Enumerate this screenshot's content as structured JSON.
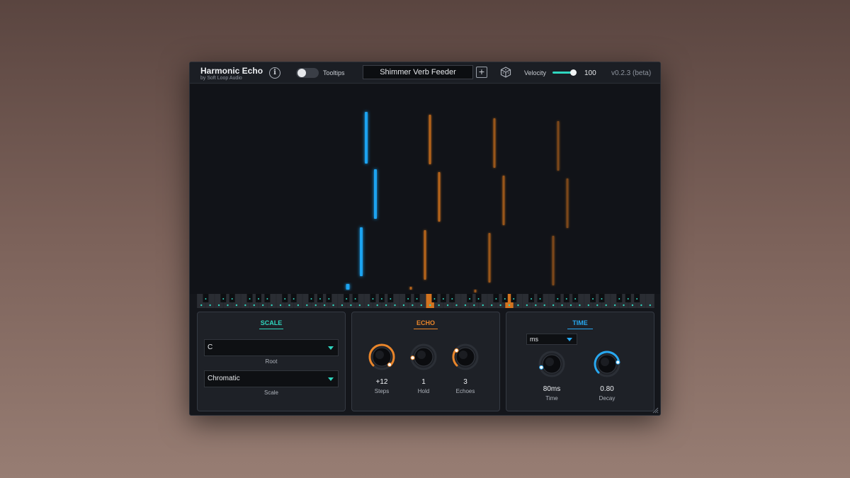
{
  "header": {
    "title": "Harmonic Echo",
    "subtitle": "by Soft Loop Audio",
    "info_glyph": "i",
    "tooltips_label": "Tooltips",
    "tooltips_on": false,
    "preset_name": "Shimmer Verb Feeder",
    "add_glyph": "+",
    "velocity_label": "Velocity",
    "velocity_value": "100",
    "velocity_fraction": 1.0,
    "version": "v0.2.3 (beta)"
  },
  "colors": {
    "accent_teal": "#2fd6bf",
    "echo_orange": "#e9852a",
    "time_blue": "#28a8f0",
    "note_blue": "#1aa3f0",
    "note_orange": "#d2731f"
  },
  "icons": {
    "info": "info-icon",
    "add": "plus-icon",
    "dice": "dice-icon",
    "resize": "resize-grip-icon"
  },
  "scale": {
    "title": "SCALE",
    "root_value": "C",
    "root_label": "Root",
    "scale_value": "Chromatic",
    "scale_label": "Scale"
  },
  "echo": {
    "title": "ECHO",
    "knobs": [
      {
        "value": "+12",
        "label": "Steps",
        "fraction": 1.0,
        "active": true
      },
      {
        "value": "1",
        "label": "Hold",
        "fraction": 0.15,
        "active": false
      },
      {
        "value": "3",
        "label": "Echoes",
        "fraction": 0.3,
        "active": true
      }
    ]
  },
  "time": {
    "title": "TIME",
    "unit_value": "ms",
    "knobs": [
      {
        "value": "80ms",
        "label": "Time",
        "fraction": 0.1,
        "active": false
      },
      {
        "value": "0.80",
        "label": "Decay",
        "fraction": 0.8,
        "active": true
      }
    ]
  }
}
